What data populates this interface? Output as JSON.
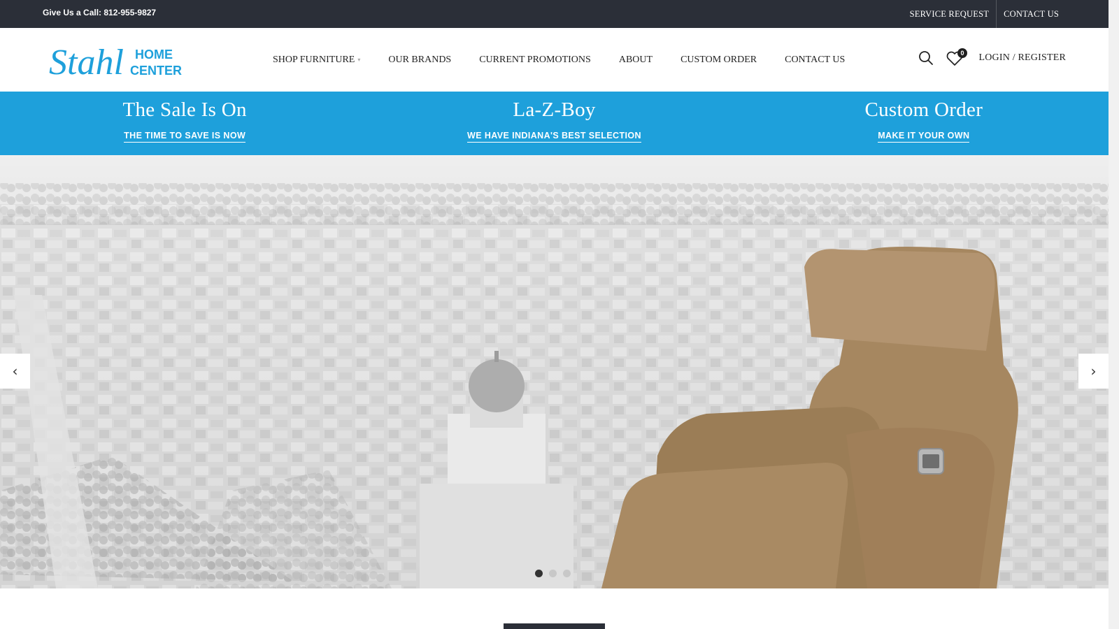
{
  "topbar": {
    "phone": "Give Us a Call: 812-955-9827",
    "links": [
      "SERVICE REQUEST",
      "CONTACT US"
    ]
  },
  "header": {
    "logo": {
      "script": "Stahl",
      "line1": "HOME",
      "line2": "CENTER",
      "script_color": "#1ea0db",
      "accent_color": "#1ea0db"
    },
    "nav": [
      {
        "label": "SHOP FURNITURE",
        "has_dropdown": true
      },
      {
        "label": "OUR BRANDS"
      },
      {
        "label": "CURRENT PROMOTIONS"
      },
      {
        "label": "ABOUT"
      },
      {
        "label": "CUSTOM ORDER"
      },
      {
        "label": "CONTACT US"
      }
    ],
    "wishlist_count": "0",
    "login_label": "LOGIN / REGISTER"
  },
  "promo": [
    {
      "title": "The Sale Is On",
      "link": "THE TIME TO SAVE IS NOW"
    },
    {
      "title": "La-Z-Boy",
      "link": "WE HAVE INDIANA'S BEST SELECTION"
    },
    {
      "title": "Custom Order",
      "link": "MAKE IT YOUR OWN"
    }
  ],
  "hero": {
    "prev_icon": "chevron-left-icon",
    "next_icon": "chevron-right-icon",
    "slide_count": 3,
    "active_slide": 1
  },
  "colors": {
    "topbar_bg": "#2b2f38",
    "promo_bg": "#1ea0db",
    "chair": "#a68760"
  }
}
